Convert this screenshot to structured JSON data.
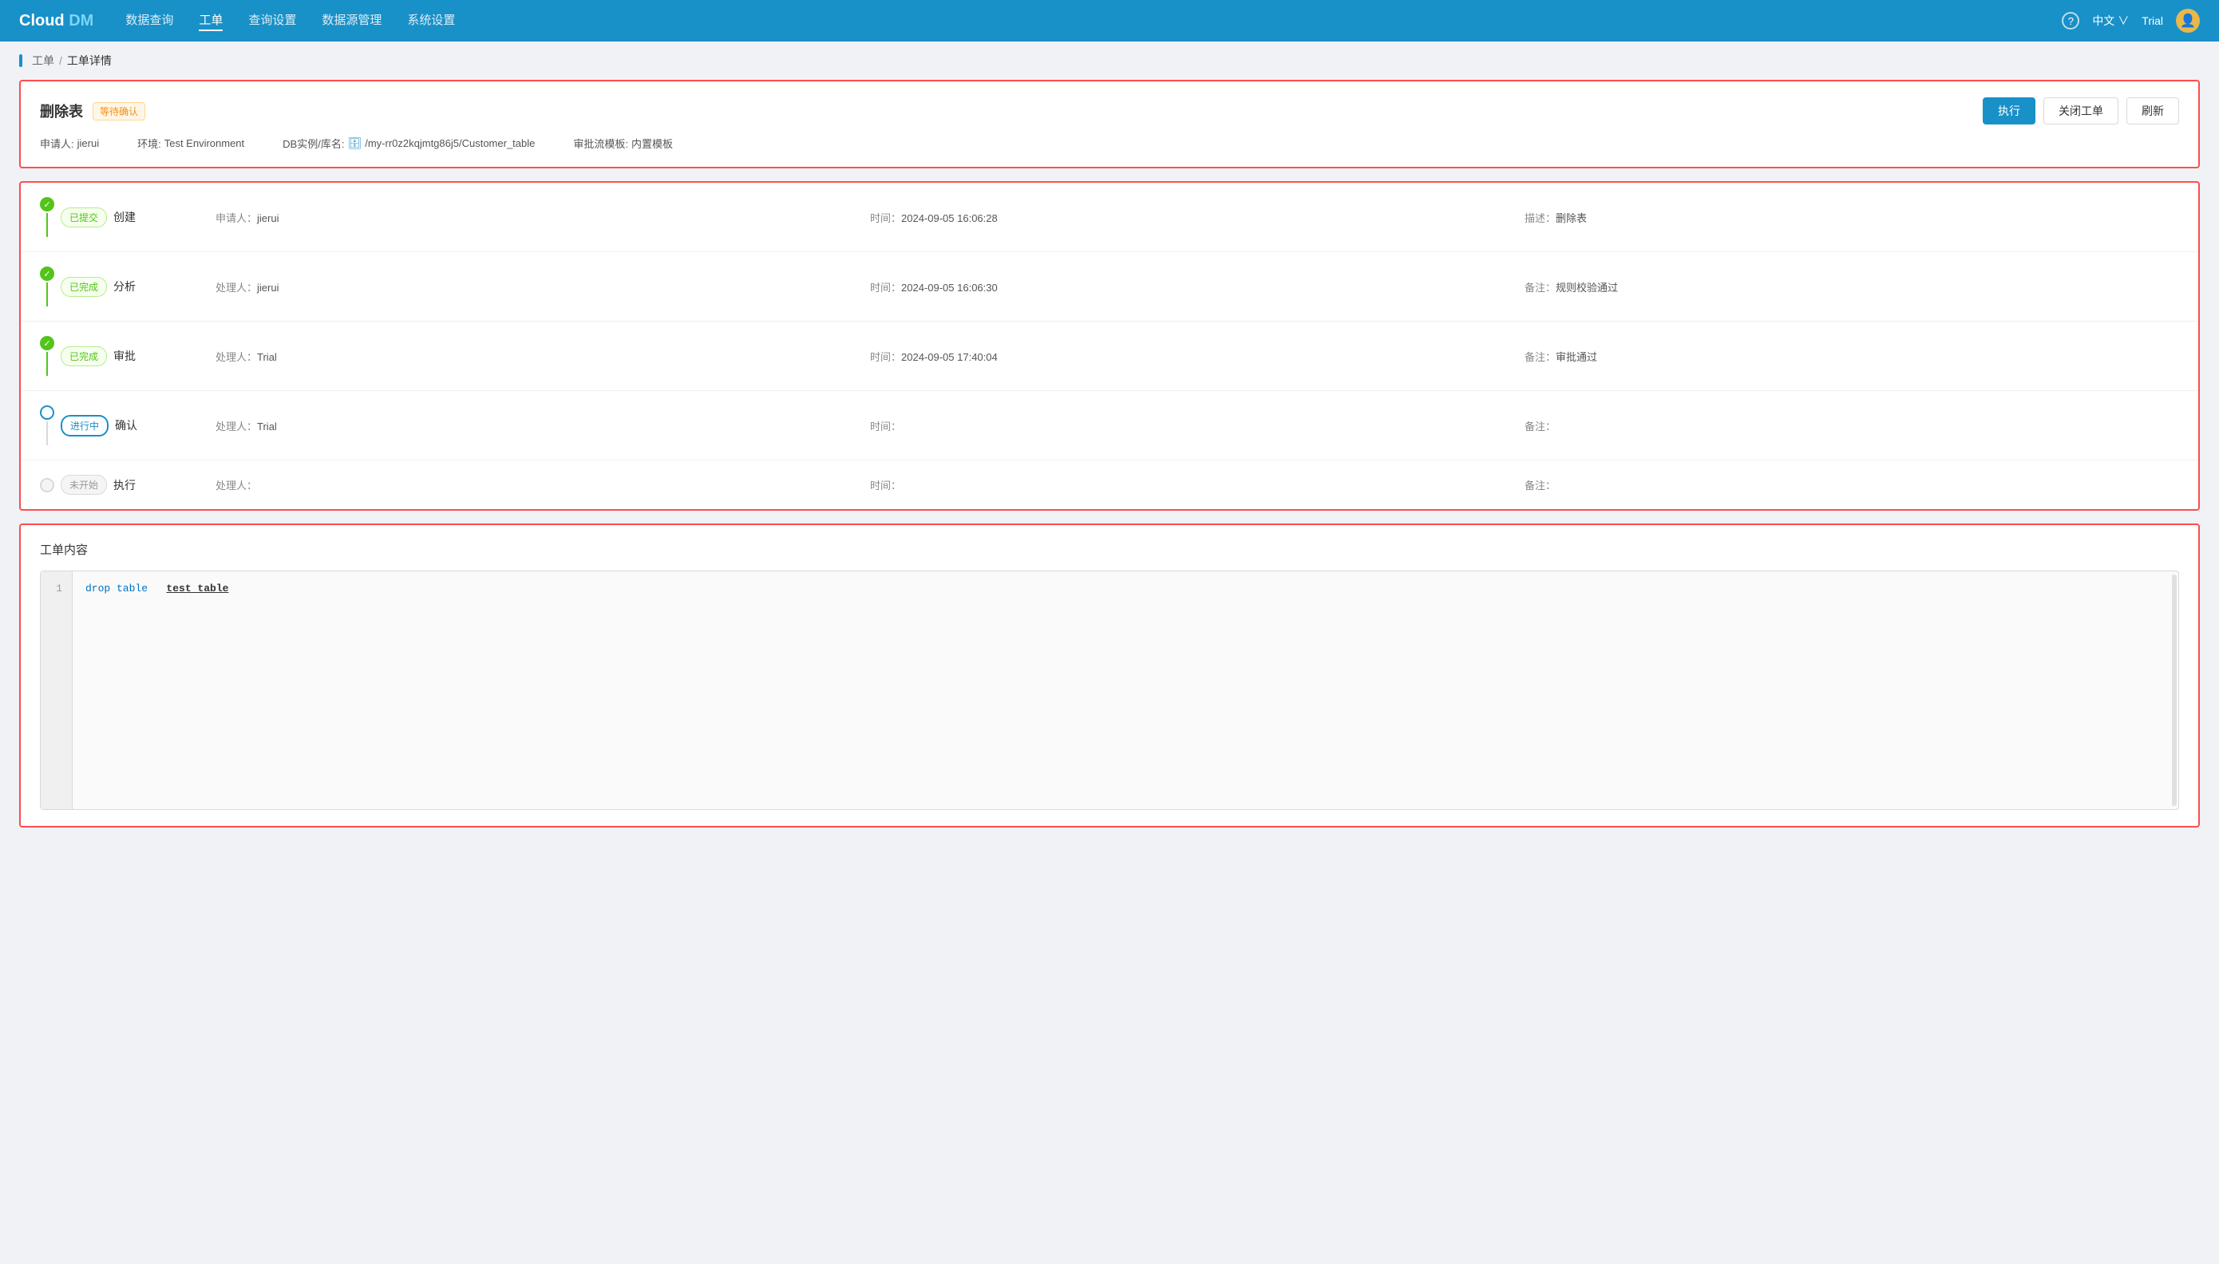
{
  "navbar": {
    "logo": "Cloud DM",
    "menu": [
      {
        "label": "数据查询",
        "active": false
      },
      {
        "label": "工单",
        "active": true
      },
      {
        "label": "查询设置",
        "active": false
      },
      {
        "label": "数据源管理",
        "active": false
      },
      {
        "label": "系统设置",
        "active": false
      }
    ],
    "help_icon": "?",
    "lang": "中文",
    "lang_arrow": "∨",
    "trial": "Trial",
    "avatar_icon": "👤"
  },
  "breadcrumb": {
    "root": "工单",
    "separator": "/",
    "current": "工单详情"
  },
  "header": {
    "title": "删除表",
    "badge": "等待确认",
    "applicant_label": "申请人:",
    "applicant": "jierui",
    "env_label": "环境:",
    "env": "Test Environment",
    "db_label": "DB实例/库名:",
    "db_path": "/my-rr0z2kqjmtg86j5/Customer_table",
    "template_label": "审批流模板:",
    "template": "内置模板",
    "btn_execute": "执行",
    "btn_close": "关闭工单",
    "btn_refresh": "刷新"
  },
  "workflow": {
    "steps": [
      {
        "status": "已提交",
        "status_type": "submitted",
        "name": "创建",
        "handler_label": "申请人:",
        "handler": "jierui",
        "time_label": "时间:",
        "time": "2024-09-05 16:06:28",
        "note_label": "描述:",
        "note": "删除表",
        "connector": true,
        "connector_color": "green"
      },
      {
        "status": "已完成",
        "status_type": "completed",
        "name": "分析",
        "handler_label": "处理人:",
        "handler": "jierui",
        "time_label": "时间:",
        "time": "2024-09-05 16:06:30",
        "note_label": "备注:",
        "note": "规则校验通过",
        "connector": true,
        "connector_color": "green"
      },
      {
        "status": "已完成",
        "status_type": "completed",
        "name": "审批",
        "handler_label": "处理人:",
        "handler": "Trial",
        "time_label": "时间:",
        "time": "2024-09-05 17:40:04",
        "note_label": "备注:",
        "note": "审批通过",
        "connector": true,
        "connector_color": "green"
      },
      {
        "status": "进行中",
        "status_type": "inprogress",
        "name": "确认",
        "handler_label": "处理人:",
        "handler": "Trial",
        "time_label": "时间:",
        "time": "",
        "note_label": "备注:",
        "note": "",
        "connector": true,
        "connector_color": "gray"
      },
      {
        "status": "未开始",
        "status_type": "notstarted",
        "name": "执行",
        "handler_label": "处理人:",
        "handler": "",
        "time_label": "时间:",
        "time": "",
        "note_label": "备注:",
        "note": "",
        "connector": false,
        "connector_color": ""
      }
    ]
  },
  "content": {
    "title": "工单内容",
    "line_number": "1",
    "code_keyword": "drop table",
    "code_table": "test_table"
  }
}
